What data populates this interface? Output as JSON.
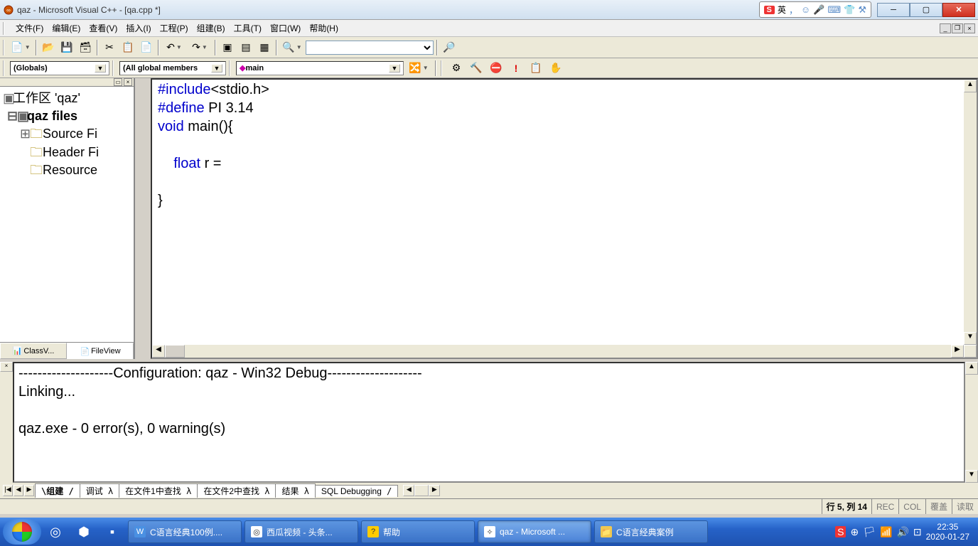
{
  "titlebar": {
    "title": "qaz - Microsoft Visual C++ - [qa.cpp *]",
    "ime_badge": "S",
    "ime_lang": "英"
  },
  "menu": [
    "文件(F)",
    "编辑(E)",
    "查看(V)",
    "插入(I)",
    "工程(P)",
    "组建(B)",
    "工具(T)",
    "窗口(W)",
    "帮助(H)"
  ],
  "combos": {
    "globals": "(Globals)",
    "members": "(All global members",
    "main": "main"
  },
  "workspace": {
    "root": "工作区 'qaz'",
    "project": "qaz files",
    "folders": [
      "Source Fi",
      "Header Fi",
      "Resource"
    ]
  },
  "side_tabs": {
    "class": "ClassV...",
    "file": "FileView"
  },
  "code": {
    "l1a": "#include",
    "l1b": "<stdio.h>",
    "l2a": "#define",
    "l2b": " PI 3.14",
    "l3a": "void",
    "l3b": " main(){",
    "l4": "",
    "l5a": "    float",
    "l5b": " r =",
    "l6": "",
    "l7": "}"
  },
  "output": {
    "l1": "--------------------Configuration: qaz - Win32 Debug--------------------",
    "l2": "Linking...",
    "l3": "",
    "l4": "qaz.exe - 0 error(s), 0 warning(s)"
  },
  "output_tabs": [
    "组建",
    "调试",
    "在文件1中查找",
    "在文件2中查找",
    "结果",
    "SQL Debugging"
  ],
  "status": {
    "pos": "行 5, 列 14",
    "rec": "REC",
    "col": "COL",
    "ovr": "覆盖",
    "read": "读取"
  },
  "taskbar": {
    "items": [
      {
        "label": "C语言经典100例....",
        "ico": "W"
      },
      {
        "label": "西瓜视频 - 头条...",
        "ico": "◎"
      },
      {
        "label": "帮助",
        "ico": "?"
      },
      {
        "label": "qaz - Microsoft ...",
        "ico": "✧"
      },
      {
        "label": "C语言经典案例",
        "ico": "📁"
      }
    ],
    "time": "22:35",
    "date": "2020-01-27"
  }
}
